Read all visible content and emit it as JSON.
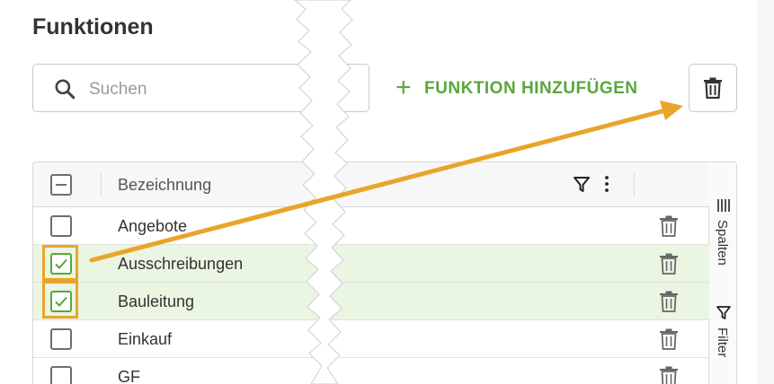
{
  "page": {
    "title": "Funktionen"
  },
  "search": {
    "placeholder": "Suchen"
  },
  "toolbar": {
    "add_plus": "+",
    "add_label": "FUNKTION HINZUFÜGEN",
    "delete_icon": "trash-icon"
  },
  "grid": {
    "column_header": "Bezeichnung",
    "rows": [
      {
        "label": "Angebote",
        "checked": false
      },
      {
        "label": "Ausschreibungen",
        "checked": true
      },
      {
        "label": "Bauleitung",
        "checked": true
      },
      {
        "label": "Einkauf",
        "checked": false
      },
      {
        "label": "GF",
        "checked": false
      }
    ]
  },
  "side_panel": {
    "columns_label": "Spalten",
    "filter_label": "Filter"
  },
  "colors": {
    "accent_green": "#5aa63c",
    "annotation_orange": "#e9a52a",
    "selected_row": "#eaf5e2"
  }
}
